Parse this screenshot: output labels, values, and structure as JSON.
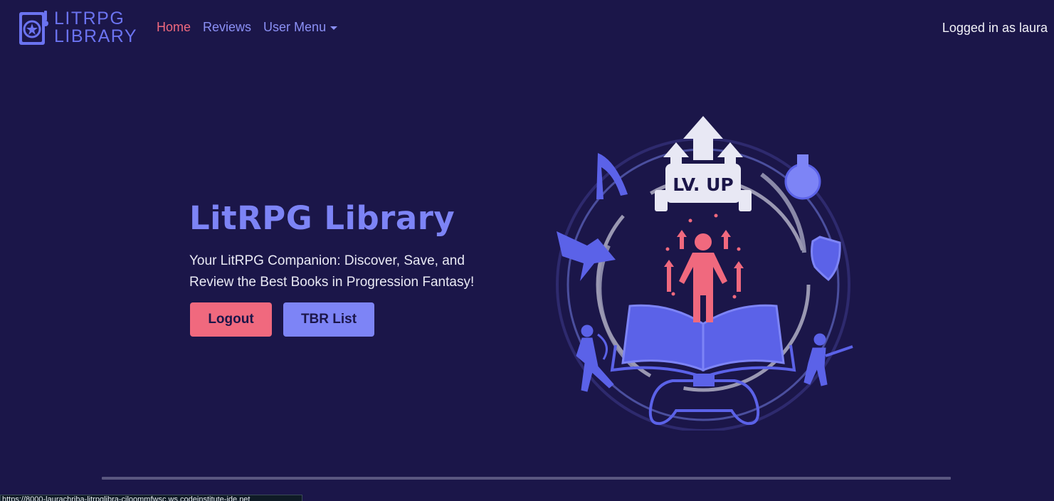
{
  "navbar": {
    "brand_line1": "LITRPG",
    "brand_line2": "LIBRARY",
    "links": [
      {
        "label": "Home",
        "active": true
      },
      {
        "label": "Reviews",
        "active": false
      },
      {
        "label": "User Menu",
        "active": false
      }
    ],
    "login_status": "Logged in as laura"
  },
  "hero": {
    "title": "LitRPG Library",
    "subtitle": "Your LitRPG Companion: Discover, Save, and Review the Best Books in Progression Fantasy!",
    "logout_label": "Logout",
    "tbr_label": "TBR List",
    "art_badge": "LV. UP"
  },
  "status_bar": {
    "url": "https://8000-laurachriba-litrpglibra-ciloommfwsc.ws.codeinstitute-ide.net"
  },
  "colors": {
    "background": "#1b1649",
    "accent_pink": "#f0697e",
    "accent_blue": "#7d84f6",
    "text_light": "#f2f2f8"
  }
}
